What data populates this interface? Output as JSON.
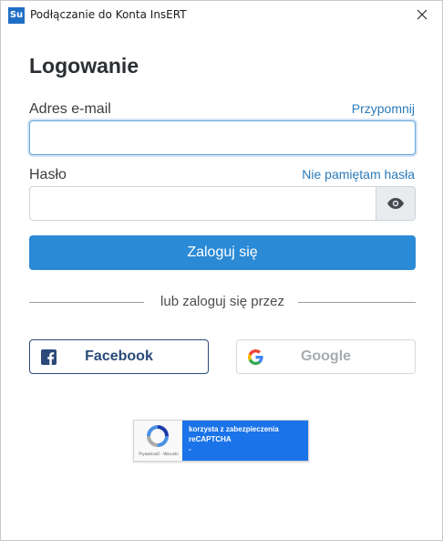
{
  "window": {
    "icon_text": "Su",
    "title": "Podłączanie do Konta InsERT"
  },
  "form": {
    "heading": "Logowanie",
    "email_label": "Adres e-mail",
    "remind_link": "Przypomnij",
    "email_value": "",
    "password_label": "Hasło",
    "forgot_link": "Nie pamiętam hasła",
    "password_value": "",
    "login_button": "Zaloguj się"
  },
  "social": {
    "divider_text": "lub zaloguj się przez",
    "facebook_label": "Facebook",
    "google_label": "Google"
  },
  "recaptcha": {
    "line1": "korzysta z zabezpieczenia",
    "line2": "reCAPTCHA",
    "line3": "-",
    "privacy": "Prywatność - Warunki"
  },
  "colors": {
    "primary": "#2b8ad6",
    "link": "#2a7ab8",
    "facebook": "#2b4a7a",
    "recaptcha_blue": "#1a73e8"
  },
  "icons": {
    "close": "close-icon",
    "eye": "eye-icon",
    "facebook": "facebook-icon",
    "google": "google-icon",
    "recaptcha": "recaptcha-logo-icon"
  }
}
